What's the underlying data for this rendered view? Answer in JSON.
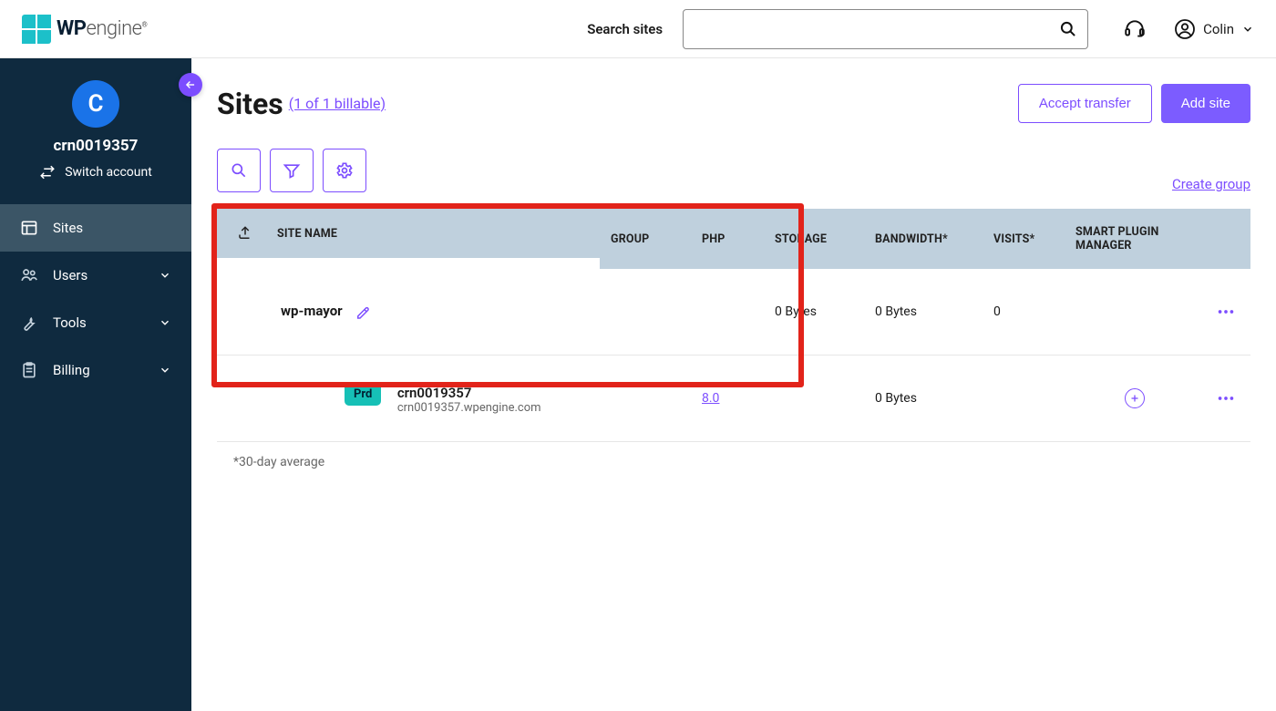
{
  "header": {
    "search_label": "Search sites",
    "search_placeholder": "",
    "user_name": "Colin"
  },
  "sidebar": {
    "account_initial": "C",
    "account_name": "crn0019357",
    "switch_label": "Switch account",
    "items": [
      {
        "label": "Sites",
        "icon": "layout",
        "active": true,
        "expandable": false
      },
      {
        "label": "Users",
        "icon": "people",
        "active": false,
        "expandable": true
      },
      {
        "label": "Tools",
        "icon": "wrench",
        "active": false,
        "expandable": true
      },
      {
        "label": "Billing",
        "icon": "clipboard",
        "active": false,
        "expandable": true
      }
    ]
  },
  "page": {
    "title": "Sites",
    "subtitle_link": "(1 of 1 billable)",
    "accept_transfer_label": "Accept transfer",
    "add_site_label": "Add site",
    "create_group_label": "Create group",
    "footnote": "*30-day average"
  },
  "columns": {
    "site_name": "SITE NAME",
    "group": "GROUP",
    "php": "PHP",
    "storage": "STORAGE",
    "bandwidth": "BANDWIDTH*",
    "visits": "VISITS*",
    "spm": "SMART PLUGIN MANAGER"
  },
  "rows": {
    "site": {
      "name": "wp-mayor",
      "group": "",
      "php": "",
      "storage": "0 Bytes",
      "bandwidth": "0 Bytes",
      "visits": "0"
    },
    "env": {
      "badge": "Prd",
      "name": "crn0019357",
      "url": "crn0019357.wpengine.com",
      "group": "",
      "php": "8.0",
      "storage": "",
      "bandwidth": "0 Bytes",
      "visits": ""
    }
  }
}
